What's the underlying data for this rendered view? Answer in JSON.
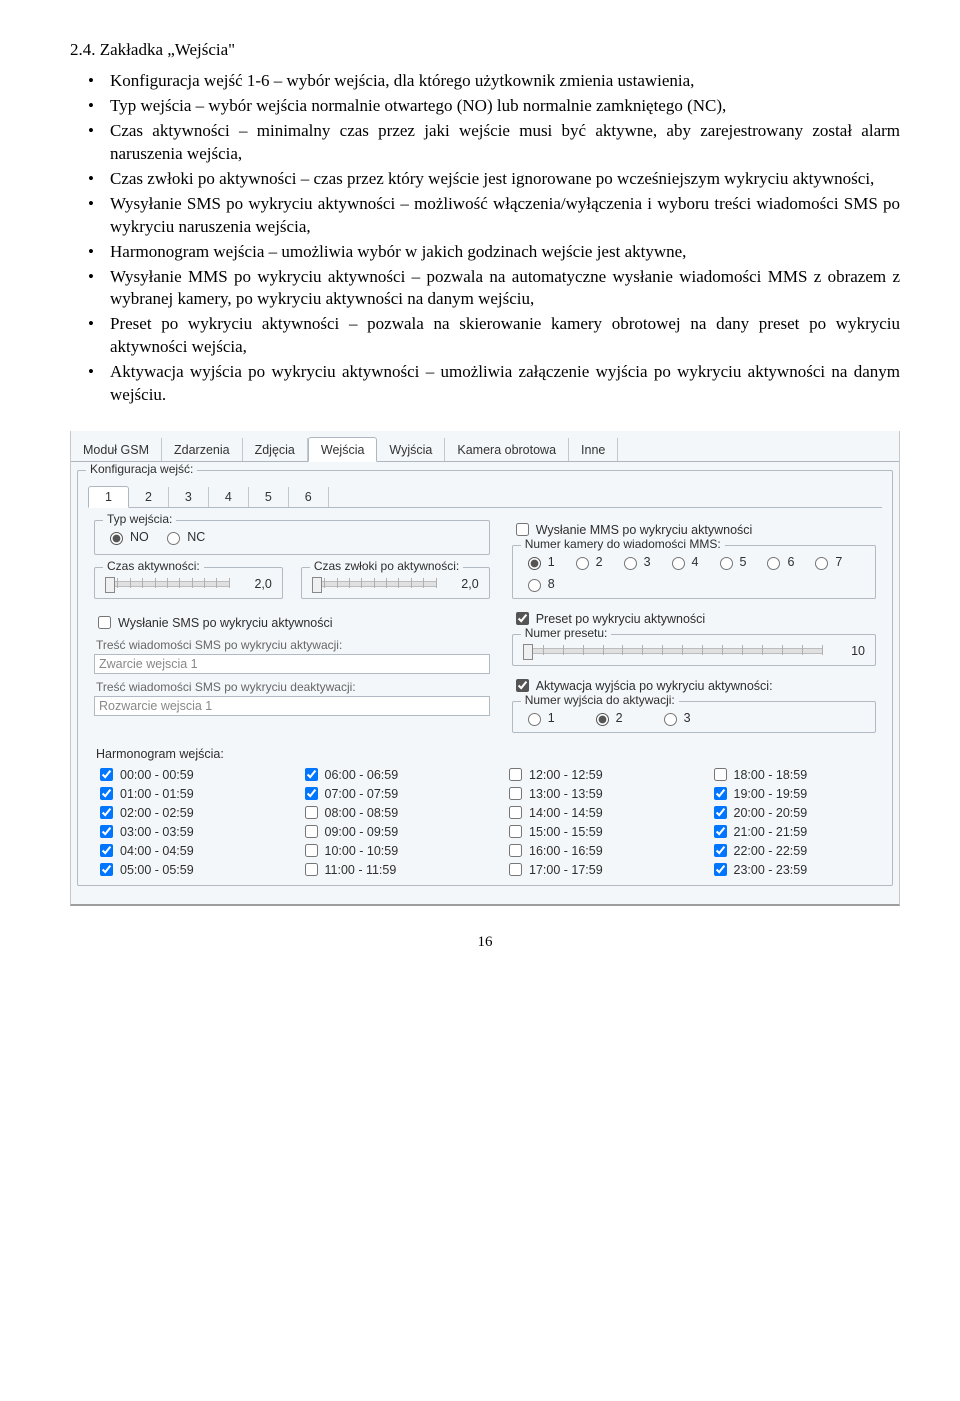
{
  "heading": "2.4. Zakładka „Wejścia\"",
  "bullets": [
    "Konfiguracja wejść 1-6 – wybór wejścia, dla którego użytkownik zmienia ustawienia,",
    "Typ wejścia – wybór wejścia normalnie otwartego (NO) lub normalnie zamkniętego (NC),",
    "Czas aktywności – minimalny czas przez jaki wejście musi być aktywne, aby zarejestrowany został alarm naruszenia wejścia,",
    "Czas zwłoki po aktywności – czas przez który wejście jest ignorowane po wcześniejszym wykryciu aktywności,",
    "Wysyłanie SMS po wykryciu aktywności – możliwość włączenia/wyłączenia i wyboru treści wiadomości SMS po wykryciu naruszenia wejścia,",
    "Harmonogram wejścia – umożliwia wybór w jakich godzinach wejście jest aktywne,",
    "Wysyłanie MMS po wykryciu aktywności – pozwala na automatyczne wysłanie wiadomości MMS z obrazem z wybranej kamery, po wykryciu aktywności na danym wejściu,",
    "Preset po wykryciu aktywności – pozwala na skierowanie kamery obrotowej na dany preset po wykryciu aktywności wejścia,",
    "Aktywacja wyjścia po wykryciu aktywności – umożliwia załączenie wyjścia po wykryciu aktywności na danym wejściu."
  ],
  "main_tabs": [
    "Moduł GSM",
    "Zdarzenia",
    "Zdjęcia",
    "Wejścia",
    "Wyjścia",
    "Kamera obrotowa",
    "Inne"
  ],
  "main_tab_active": 3,
  "konf_legend": "Konfiguracja wejść:",
  "konf_tabs": [
    "1",
    "2",
    "3",
    "4",
    "5",
    "6"
  ],
  "konf_active": 0,
  "typ": {
    "legend": "Typ wejścia:",
    "no": "NO",
    "nc": "NC",
    "value": "NO"
  },
  "czas_akt": {
    "legend": "Czas aktywności:",
    "value": "2,0"
  },
  "czas_zwl": {
    "legend": "Czas zwłoki po aktywności:",
    "value": "2,0"
  },
  "sms_chk": "Wysłanie SMS po wykryciu aktywności",
  "sms_act_lbl": "Treść wiadomości SMS po wykryciu aktywacji:",
  "sms_act_val": "Zwarcie wejscia 1",
  "sms_deact_lbl": "Treść wiadomości SMS po wykryciu deaktywacji:",
  "sms_deact_val": "Rozwarcie wejscia 1",
  "mms_chk": "Wysłanie MMS po wykryciu aktywności",
  "mms_grp": "Numer kamery do wiadomości MMS:",
  "mms_opts": [
    "1",
    "2",
    "3",
    "4",
    "5",
    "6",
    "7",
    "8"
  ],
  "mms_sel": 0,
  "preset_chk": "Preset po wykryciu aktywności",
  "preset_grp": "Numer presetu:",
  "preset_val": "10",
  "out_chk": "Aktywacja wyjścia po wykryciu aktywności:",
  "out_grp": "Numer wyjścia do aktywacji:",
  "out_opts": [
    "1",
    "2",
    "3"
  ],
  "out_sel": 1,
  "sched_lbl": "Harmonogram wejścia:",
  "sched": [
    {
      "t": "00:00 - 00:59",
      "c": true
    },
    {
      "t": "01:00 - 01:59",
      "c": true
    },
    {
      "t": "02:00 - 02:59",
      "c": true
    },
    {
      "t": "03:00 - 03:59",
      "c": true
    },
    {
      "t": "04:00 - 04:59",
      "c": true
    },
    {
      "t": "05:00 - 05:59",
      "c": true
    },
    {
      "t": "06:00 - 06:59",
      "c": true
    },
    {
      "t": "07:00 - 07:59",
      "c": true
    },
    {
      "t": "08:00 - 08:59",
      "c": false
    },
    {
      "t": "09:00 - 09:59",
      "c": false
    },
    {
      "t": "10:00 - 10:59",
      "c": false
    },
    {
      "t": "11:00 - 11:59",
      "c": false
    },
    {
      "t": "12:00 - 12:59",
      "c": false
    },
    {
      "t": "13:00 - 13:59",
      "c": false
    },
    {
      "t": "14:00 - 14:59",
      "c": false
    },
    {
      "t": "15:00 - 15:59",
      "c": false
    },
    {
      "t": "16:00 - 16:59",
      "c": false
    },
    {
      "t": "17:00 - 17:59",
      "c": false
    },
    {
      "t": "18:00 - 18:59",
      "c": false
    },
    {
      "t": "19:00 - 19:59",
      "c": true
    },
    {
      "t": "20:00 - 20:59",
      "c": true
    },
    {
      "t": "21:00 - 21:59",
      "c": true
    },
    {
      "t": "22:00 - 22:59",
      "c": true
    },
    {
      "t": "23:00 - 23:59",
      "c": true
    }
  ],
  "page": "16"
}
